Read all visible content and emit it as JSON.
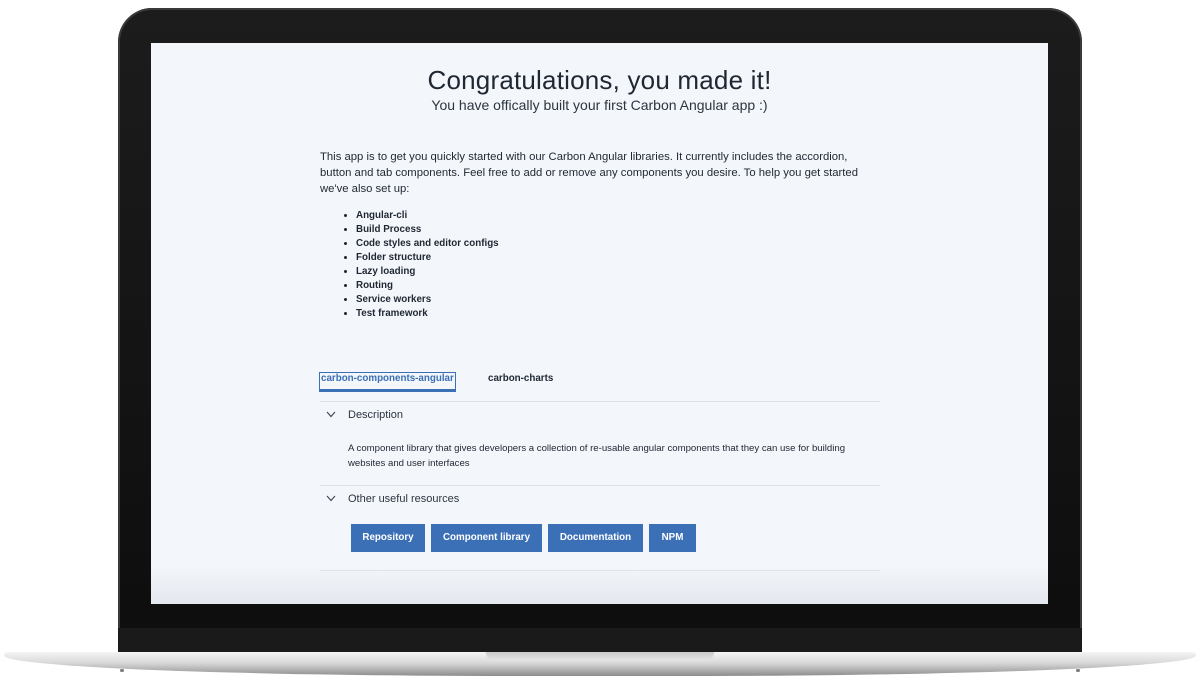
{
  "hero": {
    "title": "Congratulations, you made it!",
    "subtitle": "You have offically built your first Carbon Angular app :)"
  },
  "intro": {
    "text": "This app is to get you quickly started with our Carbon Angular libraries. It currently includes the accordion, button and tab components. Feel free to add or remove any components you desire. To help you get started we've also set up:"
  },
  "features": [
    "Angular-cli",
    "Build Process",
    "Code styles and editor configs",
    "Folder structure",
    "Lazy loading",
    "Routing",
    "Service workers",
    "Test framework"
  ],
  "tabs": [
    {
      "label": "carbon-components-angular",
      "active": true
    },
    {
      "label": "carbon-charts",
      "active": false
    }
  ],
  "accordion": {
    "description": {
      "title": "Description",
      "body": "A component library that gives developers a collection of re-usable angular components that they can use for building websites and user interfaces"
    },
    "resources": {
      "title": "Other useful resources",
      "buttons": [
        "Repository",
        "Component library",
        "Documentation",
        "NPM"
      ]
    }
  },
  "colors": {
    "accent": "#3b6fb6",
    "screen_bg": "#f3f6fa",
    "text": "#1f2733"
  },
  "icons": {
    "accordion_toggle": "chevron-down-icon"
  }
}
